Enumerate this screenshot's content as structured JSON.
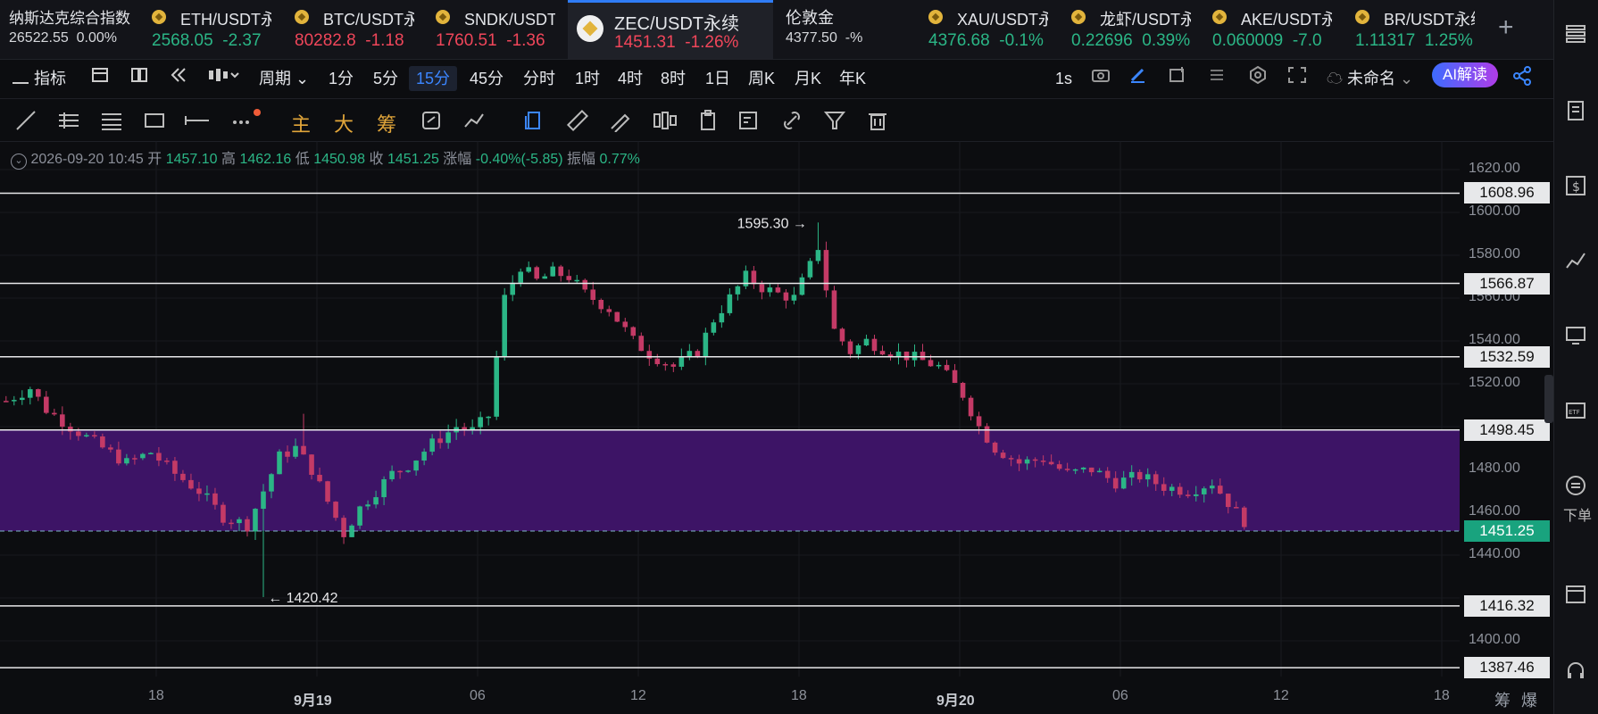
{
  "tickers": [
    {
      "name": "纳斯达克综合指数",
      "price": "26522.55",
      "change": "0.00%",
      "color": "w",
      "coin": false
    },
    {
      "name": "ETH/USDT永续",
      "price": "2568.05",
      "change": "-2.37",
      "color": "g",
      "coin": true
    },
    {
      "name": "BTC/USDT永续",
      "price": "80282.8",
      "change": "-1.18",
      "color": "r",
      "coin": true
    },
    {
      "name": "SNDK/USDT永续",
      "price": "1760.51",
      "change": "-1.36",
      "color": "r",
      "coin": true
    },
    {
      "name": "ZEC/USDT永续",
      "price": "1451.31",
      "change": "-1.26%",
      "color": "r",
      "coin": true,
      "active": true
    },
    {
      "name": "伦敦金",
      "price": "4377.50",
      "change": "-%",
      "color": "w",
      "coin": false
    },
    {
      "name": "XAU/USDT永续",
      "price": "4376.68",
      "change": "-0.1%",
      "color": "g",
      "coin": true
    },
    {
      "name": "龙虾/USDT永续",
      "price": "0.22696",
      "change": "0.39%",
      "color": "g",
      "coin": true
    },
    {
      "name": "AKE/USDT永续",
      "price": "0.060009",
      "change": "-7.0",
      "color": "g",
      "coin": true
    },
    {
      "name": "BR/USDT永续",
      "price": "1.11317",
      "change": "1.25%",
      "color": "g",
      "coin": true
    }
  ],
  "toolbar": {
    "indicator": "指标",
    "period": "周期",
    "intervals": [
      "1分",
      "5分",
      "15分",
      "45分",
      "分时",
      "1时",
      "4时",
      "8时",
      "1日",
      "周K",
      "月K",
      "年K"
    ],
    "selected": "15分",
    "refresh": "1s",
    "layout_name": "未命名",
    "ai_label": "AI解读"
  },
  "drawbar": {
    "main": "主",
    "big": "大",
    "chip": "筹"
  },
  "ohlc": {
    "datetime": "2026-09-20 10:45",
    "open_label": "开",
    "open": "1457.10",
    "high_label": "高",
    "high": "1462.16",
    "low_label": "低",
    "low": "1450.98",
    "close_label": "收",
    "close": "1451.25",
    "change_label": "涨幅",
    "change": "-0.40%(-5.85)",
    "amp_label": "振幅",
    "amp": "0.77%"
  },
  "chart_data": {
    "type": "candlestick",
    "symbol": "ZEC/USDT永续",
    "interval": "15分",
    "y_ticks": [
      1620,
      1600,
      1580,
      1560,
      1540,
      1520,
      1500,
      1480,
      1460,
      1440,
      1420,
      1400
    ],
    "y_tick_labels": [
      "1620.00",
      "1600.00",
      "1580.00",
      "1560.00",
      "1540.00",
      "1520.00",
      "",
      "1480.00",
      "1460.00",
      "1440.00",
      "",
      "1400.00"
    ],
    "x_ticks": [
      "18",
      "9月19",
      "06",
      "12",
      "18",
      "9月20",
      "06",
      "12",
      "18"
    ],
    "horizontal_lines": [
      1608.96,
      1566.87,
      1532.59,
      1498.45,
      1416.32,
      1387.46
    ],
    "current_price": 1451.25,
    "zone": {
      "from": 1451.25,
      "to": 1498.45,
      "color": "#3d1466"
    },
    "annotations": [
      {
        "text": "1595.30 →",
        "price": 1595.3
      },
      {
        "text": "← 1420.42",
        "price": 1420.42
      }
    ],
    "up_color": "#2bb686",
    "down_color": "#c43a66",
    "close_path": [
      [
        0,
        1512
      ],
      [
        3,
        1518
      ],
      [
        5,
        1508
      ],
      [
        8,
        1500
      ],
      [
        12,
        1490
      ],
      [
        15,
        1483
      ],
      [
        18,
        1488
      ],
      [
        21,
        1478
      ],
      [
        24,
        1470
      ],
      [
        27,
        1458
      ],
      [
        30,
        1454
      ],
      [
        32,
        1470
      ],
      [
        34,
        1486
      ],
      [
        36,
        1490
      ],
      [
        38,
        1480
      ],
      [
        40,
        1465
      ],
      [
        42,
        1450
      ],
      [
        44,
        1462
      ],
      [
        46,
        1470
      ],
      [
        48,
        1478
      ],
      [
        50,
        1482
      ],
      [
        53,
        1492
      ],
      [
        56,
        1500
      ],
      [
        58,
        1498
      ],
      [
        60,
        1505
      ],
      [
        62,
        1560
      ],
      [
        64,
        1575
      ],
      [
        66,
        1568
      ],
      [
        68,
        1572
      ],
      [
        70,
        1570
      ],
      [
        72,
        1562
      ],
      [
        75,
        1555
      ],
      [
        78,
        1540
      ],
      [
        80,
        1534
      ],
      [
        83,
        1528
      ],
      [
        86,
        1535
      ],
      [
        88,
        1550
      ],
      [
        90,
        1560
      ],
      [
        92,
        1570
      ],
      [
        94,
        1565
      ],
      [
        96,
        1562
      ],
      [
        98,
        1560
      ],
      [
        100,
        1575
      ],
      [
        101,
        1584
      ],
      [
        103,
        1545
      ],
      [
        105,
        1535
      ],
      [
        107,
        1540
      ],
      [
        110,
        1535
      ],
      [
        113,
        1532
      ],
      [
        116,
        1528
      ],
      [
        119,
        1515
      ],
      [
        121,
        1500
      ],
      [
        123,
        1490
      ],
      [
        126,
        1483
      ],
      [
        129,
        1485
      ],
      [
        132,
        1478
      ],
      [
        135,
        1480
      ],
      [
        138,
        1474
      ],
      [
        141,
        1477
      ],
      [
        144,
        1472
      ],
      [
        147,
        1470
      ],
      [
        150,
        1474
      ],
      [
        153,
        1460
      ],
      [
        155,
        1452
      ]
    ],
    "candles": 155
  },
  "right_rail": {
    "bottom_label": "下单"
  },
  "footer": {
    "chip": "筹",
    "burst": "爆"
  }
}
